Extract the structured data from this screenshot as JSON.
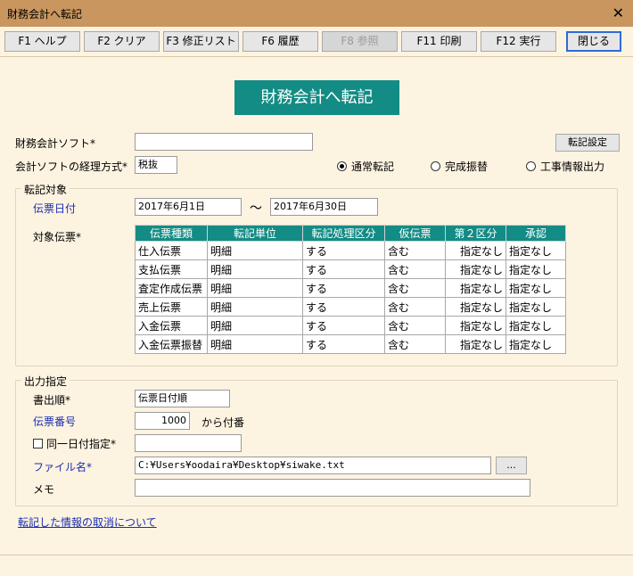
{
  "window": {
    "title": "財務会計へ転記",
    "close_glyph": "✕"
  },
  "toolbar": {
    "buttons": [
      {
        "label": "F1 ヘルプ",
        "enabled": true
      },
      {
        "label": "F2 クリア",
        "enabled": true
      },
      {
        "label": "F3 修正リスト",
        "enabled": true
      },
      {
        "label": "F6 履歴",
        "enabled": true
      },
      {
        "label": "F8 参照",
        "enabled": false
      },
      {
        "label": "F11 印刷",
        "enabled": true
      },
      {
        "label": "F12 実行",
        "enabled": true
      }
    ],
    "close_label": "閉じる"
  },
  "banner": "財務会計へ転記",
  "software": {
    "label": "財務会計ソフト*",
    "value": ""
  },
  "settings_button": "転記設定",
  "tax_method": {
    "label": "会計ソフトの経理方式*",
    "value": "税抜"
  },
  "transfer_modes": [
    {
      "label": "通常転記",
      "selected": true
    },
    {
      "label": "完成振替",
      "selected": false
    },
    {
      "label": "工事情報出力",
      "selected": false
    }
  ],
  "target": {
    "legend": "転記対象",
    "date_label": "伝票日付",
    "date_from": "2017年6月1日",
    "tilde": "～",
    "date_to": "2017年6月30日",
    "voucher_label": "対象伝票*",
    "table": {
      "headers": [
        "伝票種類",
        "転記単位",
        "転記処理区分",
        "仮伝票",
        "第２区分",
        "承認"
      ],
      "rows": [
        [
          "仕入伝票",
          "明細",
          "する",
          "含む",
          "指定なし",
          "指定なし"
        ],
        [
          "支払伝票",
          "明細",
          "する",
          "含む",
          "指定なし",
          "指定なし"
        ],
        [
          "査定作成伝票",
          "明細",
          "する",
          "含む",
          "指定なし",
          "指定なし"
        ],
        [
          "売上伝票",
          "明細",
          "する",
          "含む",
          "指定なし",
          "指定なし"
        ],
        [
          "入金伝票",
          "明細",
          "する",
          "含む",
          "指定なし",
          "指定なし"
        ],
        [
          "入金伝票振替",
          "明細",
          "する",
          "含む",
          "指定なし",
          "指定なし"
        ]
      ]
    }
  },
  "output": {
    "legend": "出力指定",
    "order_label": "書出順*",
    "order_value": "伝票日付順",
    "number_label": "伝票番号",
    "number_value": "1000",
    "number_suffix": "から付番",
    "same_date_label": "同一日付指定*",
    "same_date_checked": false,
    "same_date_value": "",
    "file_label": "ファイル名*",
    "file_value": "C:¥Users¥oodaira¥Desktop¥siwake.txt",
    "browse_label": "...",
    "memo_label": "メモ",
    "memo_value": ""
  },
  "cancel_link": "転記した情報の取消について",
  "colors": {
    "accent": "#138c85",
    "background": "#fdf3e1",
    "titlebar": "#c8965e",
    "link": "#1a2fb0"
  }
}
